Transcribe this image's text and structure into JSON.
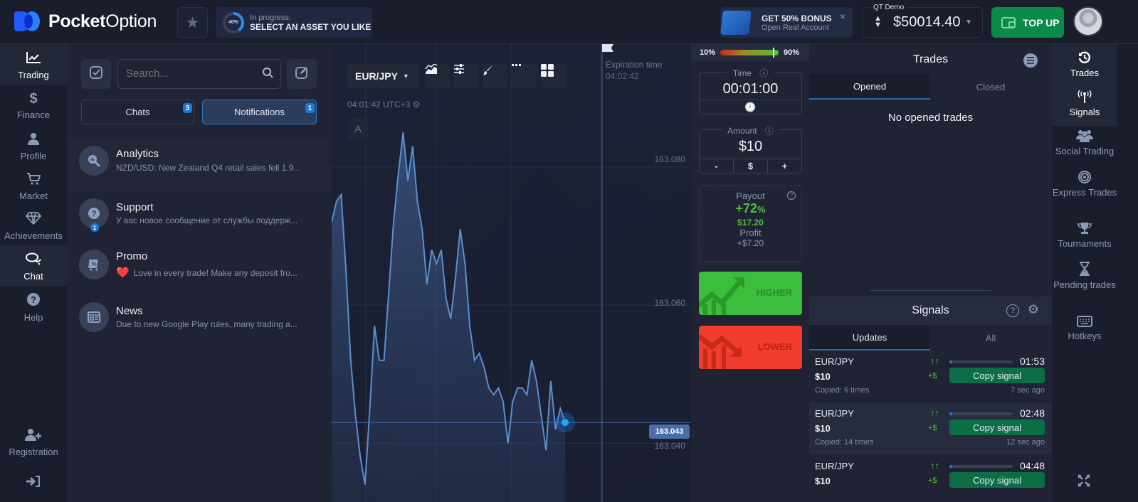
{
  "topbar": {
    "logo_bold": "Pocket",
    "logo_light": "Option",
    "progress_percent": 40,
    "progress_label": "40%",
    "progress_status": "In progress:",
    "progress_task": "SELECT AN ASSET YOU LIKE",
    "bonus_title": "GET 50% BONUS",
    "bonus_subtitle": "Open Real Account",
    "bonus_close": "×",
    "account_label": "QT Demo",
    "balance": "$50014.40",
    "topup_label": "TOP UP"
  },
  "left_nav": [
    {
      "label": "Trading",
      "icon": "chart-line-icon",
      "glyph": "📈",
      "active": false
    },
    {
      "label": "Finance",
      "icon": "dollar-icon",
      "glyph": "$",
      "active": false
    },
    {
      "label": "Profile",
      "icon": "user-icon",
      "glyph": "👤",
      "active": false
    },
    {
      "label": "Market",
      "icon": "cart-icon",
      "glyph": "🛒",
      "active": false
    },
    {
      "label": "Achievements",
      "icon": "diamond-icon",
      "glyph": "💎",
      "active": false
    },
    {
      "label": "Chat",
      "icon": "chat-icon",
      "glyph": "💬",
      "active": true
    },
    {
      "label": "Help",
      "icon": "help-icon",
      "glyph": "?",
      "active": false
    },
    {
      "label": "Registration",
      "icon": "user-plus-icon",
      "glyph": "👤+",
      "active": false
    },
    {
      "label": "",
      "icon": "sign-in-icon",
      "glyph": "➜]",
      "active": false
    }
  ],
  "chat_panel": {
    "search_placeholder": "Search...",
    "tabs": [
      {
        "label": "Chats",
        "badge": "3"
      },
      {
        "label": "Notifications",
        "badge": "1"
      }
    ],
    "notifications": [
      {
        "title": "Analytics",
        "text": "NZD/USD: New Zealand Q4 retail sales fell 1.9...",
        "icon": "analytics-search-icon",
        "glyph": "🔍",
        "badge": ""
      },
      {
        "title": "Support",
        "text": "У вас новое сообщение от службы поддерж...",
        "icon": "question-icon",
        "glyph": "?",
        "badge": "1"
      },
      {
        "title": "Promo",
        "text": "Love in every trade! Make any deposit fro...",
        "icon": "promo-cart-icon",
        "glyph": "%",
        "emoji": "❤️",
        "badge": ""
      },
      {
        "title": "News",
        "text": "Due to new Google Play rules, many trading a...",
        "icon": "newspaper-icon",
        "glyph": "▤",
        "badge": ""
      }
    ]
  },
  "chart": {
    "asset": "EUR/JPY",
    "time_utc": "04:01:42 UTC+3",
    "drawing_mode": "A",
    "expiration_label": "Expiration time",
    "expiration_time": "04:02:42",
    "current_price": "163.043",
    "y_labels": [
      "163.080",
      "163.060",
      "163.040"
    ]
  },
  "chart_data": {
    "type": "area",
    "title": "EUR/JPY",
    "xlabel": "",
    "ylabel": "",
    "ylim": [
      163.0355,
      163.0875
    ],
    "y_ticks": [
      163.08,
      163.06,
      163.04
    ],
    "current_price": 163.043,
    "values": [
      163.072,
      163.075,
      163.076,
      163.065,
      163.052,
      163.044,
      163.038,
      163.034,
      163.045,
      163.057,
      163.052,
      163.052,
      163.062,
      163.072,
      163.079,
      163.085,
      163.078,
      163.083,
      163.075,
      163.071,
      163.063,
      163.068,
      163.066,
      163.068,
      163.061,
      163.058,
      163.064,
      163.071,
      163.066,
      163.057,
      163.052,
      163.053,
      163.051,
      163.048,
      163.047,
      163.048,
      163.046,
      163.04,
      163.046,
      163.048,
      163.048,
      163.047,
      163.052,
      163.049,
      163.044,
      163.039,
      163.049,
      163.042,
      163.045,
      163.043
    ]
  },
  "trade_panel": {
    "sentiment_low": "10%",
    "sentiment_high": "90%",
    "sentiment_value": 0.9,
    "time_label": "Time",
    "time_value": "00:01:00",
    "amount_label": "Amount",
    "amount_value": "$10",
    "amount_minus": "-",
    "amount_currency": "$",
    "amount_plus": "+",
    "payout_label": "Payout",
    "payout_percent": "+72",
    "payout_percent_sign": "%",
    "payout_amount": "$17.20",
    "profit_label": "Profit",
    "profit_value": "+$7.20",
    "higher_label": "HIGHER",
    "lower_label": "LOWER"
  },
  "trades_panel": {
    "title": "Trades",
    "tabs": [
      "Opened",
      "Closed"
    ],
    "empty_text": "No opened trades"
  },
  "signals_panel": {
    "title": "Signals",
    "tabs": [
      "Updates",
      "All"
    ],
    "signals": [
      {
        "pair": "EUR/JPY",
        "amount": "$10",
        "copied": "Copied: 6 times",
        "direction": "↑↑",
        "plus": "+$",
        "time": "01:53",
        "progress": 0.05,
        "copy_label": "Copy signal",
        "ago": "7 sec ago"
      },
      {
        "pair": "EUR/JPY",
        "amount": "$10",
        "copied": "Copied: 14 times",
        "direction": "↑↑",
        "plus": "+$",
        "time": "02:48",
        "progress": 0.05,
        "copy_label": "Copy signal",
        "ago": "12 sec ago"
      },
      {
        "pair": "EUR/JPY",
        "amount": "$10",
        "copied": "",
        "direction": "↑↑",
        "plus": "+$",
        "time": "04:48",
        "progress": 0.03,
        "copy_label": "Copy signal",
        "ago": ""
      }
    ]
  },
  "right_nav": [
    {
      "label": "Trades",
      "icon": "history-icon",
      "glyph": "↺",
      "active": true
    },
    {
      "label": "Signals",
      "icon": "antenna-icon",
      "glyph": "📡",
      "active": true
    },
    {
      "label": "Social Trading",
      "icon": "users-icon",
      "glyph": "👥",
      "active": false
    },
    {
      "label": "Express Trades",
      "icon": "target-icon",
      "glyph": "◎",
      "active": false
    },
    {
      "label": "Tournaments",
      "icon": "trophy-icon",
      "glyph": "🏆",
      "active": false
    },
    {
      "label": "Pending trades",
      "icon": "hourglass-icon",
      "glyph": "⌛",
      "active": false
    },
    {
      "label": "Hotkeys",
      "icon": "keyboard-icon",
      "glyph": "⌨",
      "active": false
    }
  ]
}
